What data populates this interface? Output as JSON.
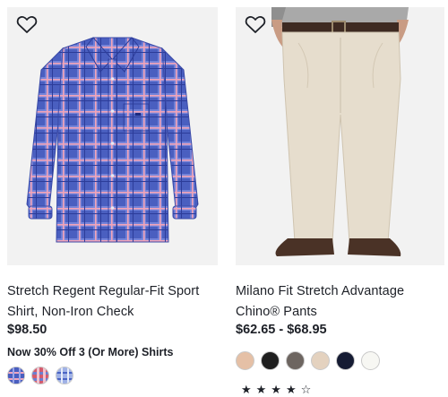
{
  "products": [
    {
      "name": "Stretch Regent Regular-Fit Sport Shirt, Non-Iron Check",
      "price": "$98.50",
      "promo": "Now 30% Off 3 (Or More) Shirts",
      "swatches": [
        "blue-pink-check",
        "red-blue-check",
        "light-blue-check"
      ]
    },
    {
      "name": "Milano Fit Stretch Advantage Chino® Pants",
      "price": "$62.65 - $68.95",
      "swatches": [
        "#e5c0a6",
        "#1f1f1f",
        "#6d6560",
        "#e4d2bf",
        "#151b33",
        "#f7f7f3"
      ],
      "rating_stars": "★★★★☆"
    }
  ],
  "icons": {
    "wishlist": "heart-outline-icon"
  },
  "colors": {
    "text": "#1d2027",
    "image_bg": "#f2f2f2"
  }
}
